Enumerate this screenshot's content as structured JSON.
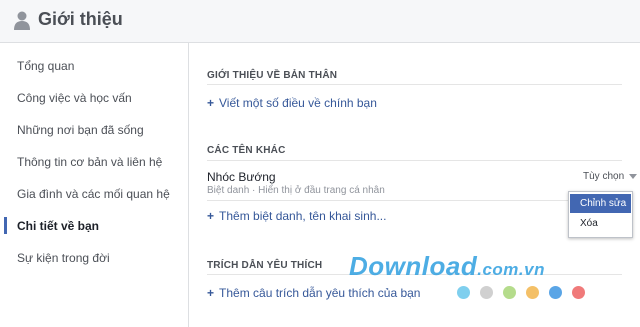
{
  "header": {
    "title": "Giới thiệu",
    "icon": "person-icon"
  },
  "sidebar": {
    "items": [
      {
        "label": "Tổng quan",
        "active": false
      },
      {
        "label": "Công việc và học vấn",
        "active": false
      },
      {
        "label": "Những nơi bạn đã sống",
        "active": false
      },
      {
        "label": "Thông tin cơ bản và liên hệ",
        "active": false
      },
      {
        "label": "Gia đình và các mối quan hệ",
        "active": false
      },
      {
        "label": "Chi tiết về bạn",
        "active": true
      },
      {
        "label": "Sự kiện trong đời",
        "active": false
      }
    ]
  },
  "sections": {
    "about": {
      "title": "GIỚI THIỆU VỀ BẢN THÂN",
      "add_label": "Viết một số điều về chính bạn"
    },
    "other_names": {
      "title": "CÁC TÊN KHÁC",
      "nickname": "Nhóc Bướng",
      "nickname_sub": "Biệt danh · Hiển thị ở đầu trang cá nhân",
      "options_label": "Tùy chọn",
      "add_label": "Thêm biệt danh, tên khai sinh..."
    },
    "quotes": {
      "title": "TRÍCH DẪN YÊU THÍCH",
      "add_label": "Thêm câu trích dẫn yêu thích của bạn"
    }
  },
  "dropdown": {
    "items": [
      {
        "label": "Chỉnh sửa",
        "selected": true
      },
      {
        "label": "Xóa",
        "selected": false
      }
    ]
  },
  "watermark": {
    "text": "Download",
    "suffix": ".com.vn"
  },
  "colors": {
    "accent": "#4267b2",
    "link": "#365899",
    "dots": [
      "#7fcfee",
      "#d0d0d0",
      "#b5dc8c",
      "#f4c067",
      "#5aa5e6",
      "#f07a7a"
    ]
  }
}
